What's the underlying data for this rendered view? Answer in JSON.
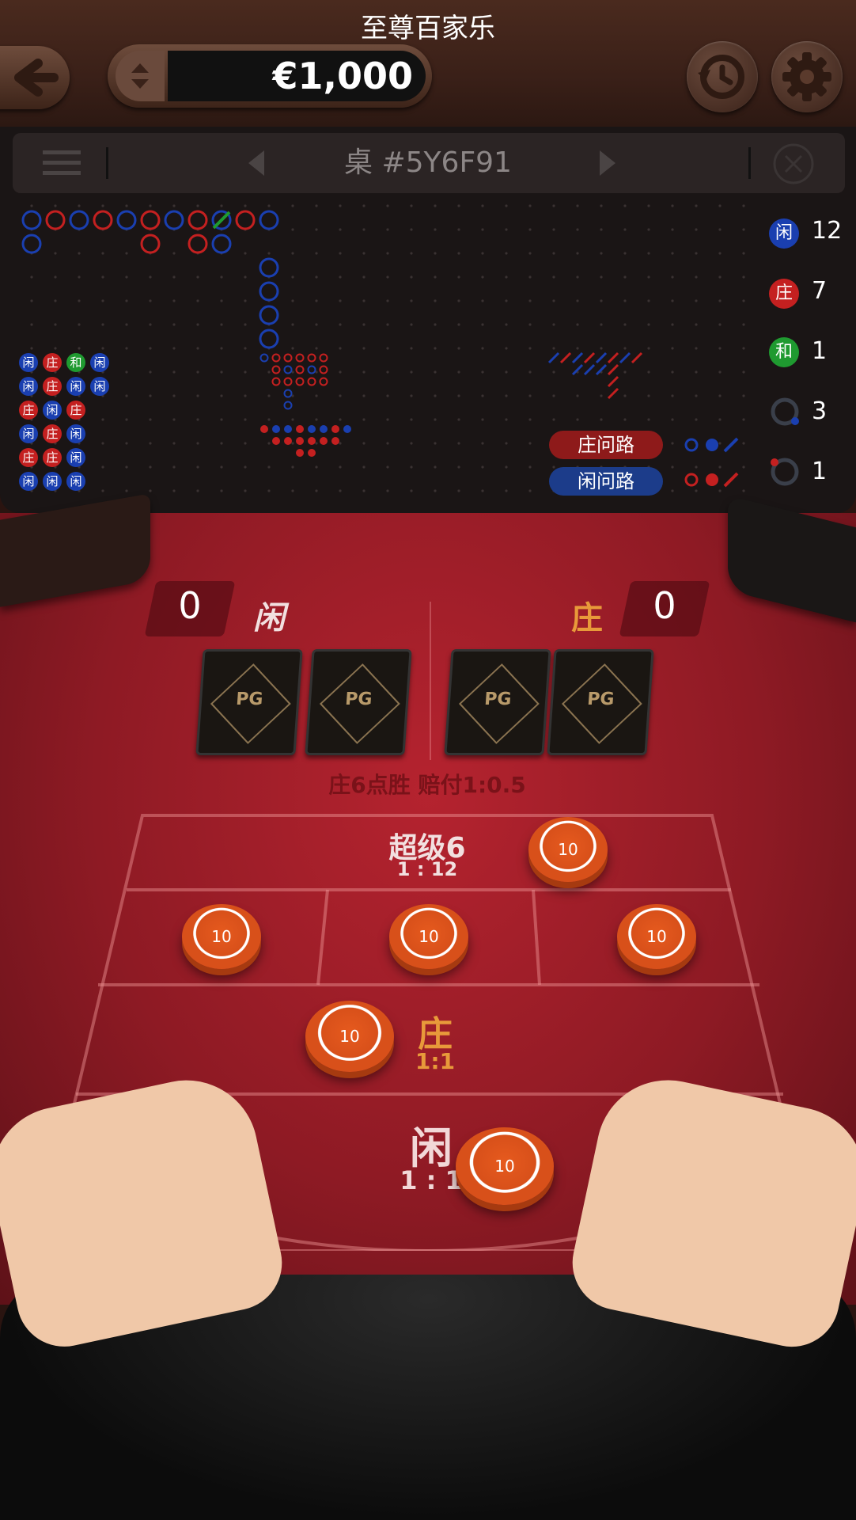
{
  "header": {
    "title": "至尊百家乐",
    "balance": "€1,000"
  },
  "tablebar": {
    "table_id": "桌 #5Y6F91"
  },
  "stats": [
    {
      "label": "闲",
      "count": "12",
      "color": "#1a3fb0"
    },
    {
      "label": "庄",
      "count": "7",
      "color": "#c42020"
    },
    {
      "label": "和",
      "count": "1",
      "color": "#1f9a30"
    },
    {
      "label": "",
      "count": "3",
      "color": "#1a3fb0"
    },
    {
      "label": "",
      "count": "1",
      "color": "#c42020"
    }
  ],
  "predict": {
    "banker_ask": "庄问路",
    "player_ask": "闲问路"
  },
  "bead_plate": {
    "rows": [
      [
        "闲",
        "庄",
        "和",
        "闲"
      ],
      [
        "闲",
        "庄",
        "闲",
        "闲"
      ],
      [
        "庄",
        "闲",
        "庄"
      ],
      [
        "闲",
        "庄",
        "闲"
      ],
      [
        "庄",
        "庄",
        "闲"
      ],
      [
        "闲",
        "闲",
        "闲"
      ]
    ]
  },
  "big_road": {
    "top_row": [
      "P",
      "B",
      "P",
      "B",
      "P",
      "B",
      "P",
      "B",
      "T",
      "B",
      "P"
    ],
    "second_row": [
      "P",
      "",
      "",
      "",
      "",
      "B",
      "",
      "B",
      "P",
      "",
      ""
    ],
    "column_tail": [
      "P",
      "P",
      "P",
      "P"
    ]
  },
  "game": {
    "player_label": "闲",
    "banker_label": "庄",
    "player_score": "0",
    "banker_score": "0",
    "result_text": "庄6点胜 赔付1:0.5"
  },
  "bets": {
    "super6_label": "超级6",
    "super6_odds": "1 : 12",
    "banker_label": "庄",
    "banker_odds": "1:1",
    "player_label": "闲",
    "player_odds": "1 : 1",
    "chip_value": "10"
  },
  "colors": {
    "banker": "#c42020",
    "player": "#1a3fb0",
    "tie": "#1f9a30",
    "felt": "#a01e2a"
  }
}
